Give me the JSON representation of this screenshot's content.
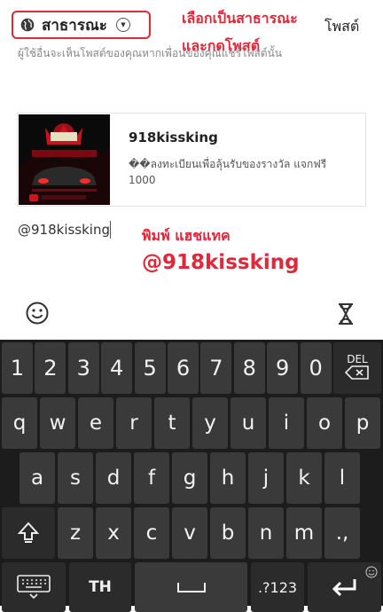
{
  "header": {
    "privacy_label": "สาธารณะ",
    "annotation_choose_public": "เลือกเป็นสาธารณะ",
    "annotation_press_post": "และกดโพสต์",
    "post_label": "โพสต์",
    "helper_text": "ผู้ใช้อื่นจะเห็นโพสต์ของคุณหากเพื่อนของคุณแชร์โพสต์นั้น"
  },
  "preview": {
    "title": "918kissking",
    "description": "��ลงทะเบียนเพื่อลุ้นรับของรางวัล แจกฟรี 1000"
  },
  "composer": {
    "text": "@918kissking",
    "annotation_type_hashtag": "พิมพ์ แฮชแทค",
    "annotation_hashtag": "@918kissking"
  },
  "icons": {
    "privacy": "globe-icon",
    "dropdown": "chevron-down-icon",
    "emoji": "emoji-icon",
    "timer": "hourglass-icon"
  },
  "keyboard": {
    "numbers": [
      "1",
      "2",
      "3",
      "4",
      "5",
      "6",
      "7",
      "8",
      "9",
      "0"
    ],
    "del_label": "DEL",
    "row1": [
      "q",
      "w",
      "e",
      "r",
      "t",
      "y",
      "u",
      "i",
      "o",
      "p"
    ],
    "row2": [
      "a",
      "s",
      "d",
      "f",
      "g",
      "h",
      "j",
      "k",
      "l"
    ],
    "row3": [
      "z",
      "x",
      "c",
      "v",
      "b",
      "n",
      "m",
      ".,"
    ],
    "lang_label": "TH",
    "symbols_label": ".?123"
  },
  "colors": {
    "accent": "#e0283a",
    "keyboard_bg": "#1c1c1c",
    "key_bg": "#3a3a3a"
  }
}
